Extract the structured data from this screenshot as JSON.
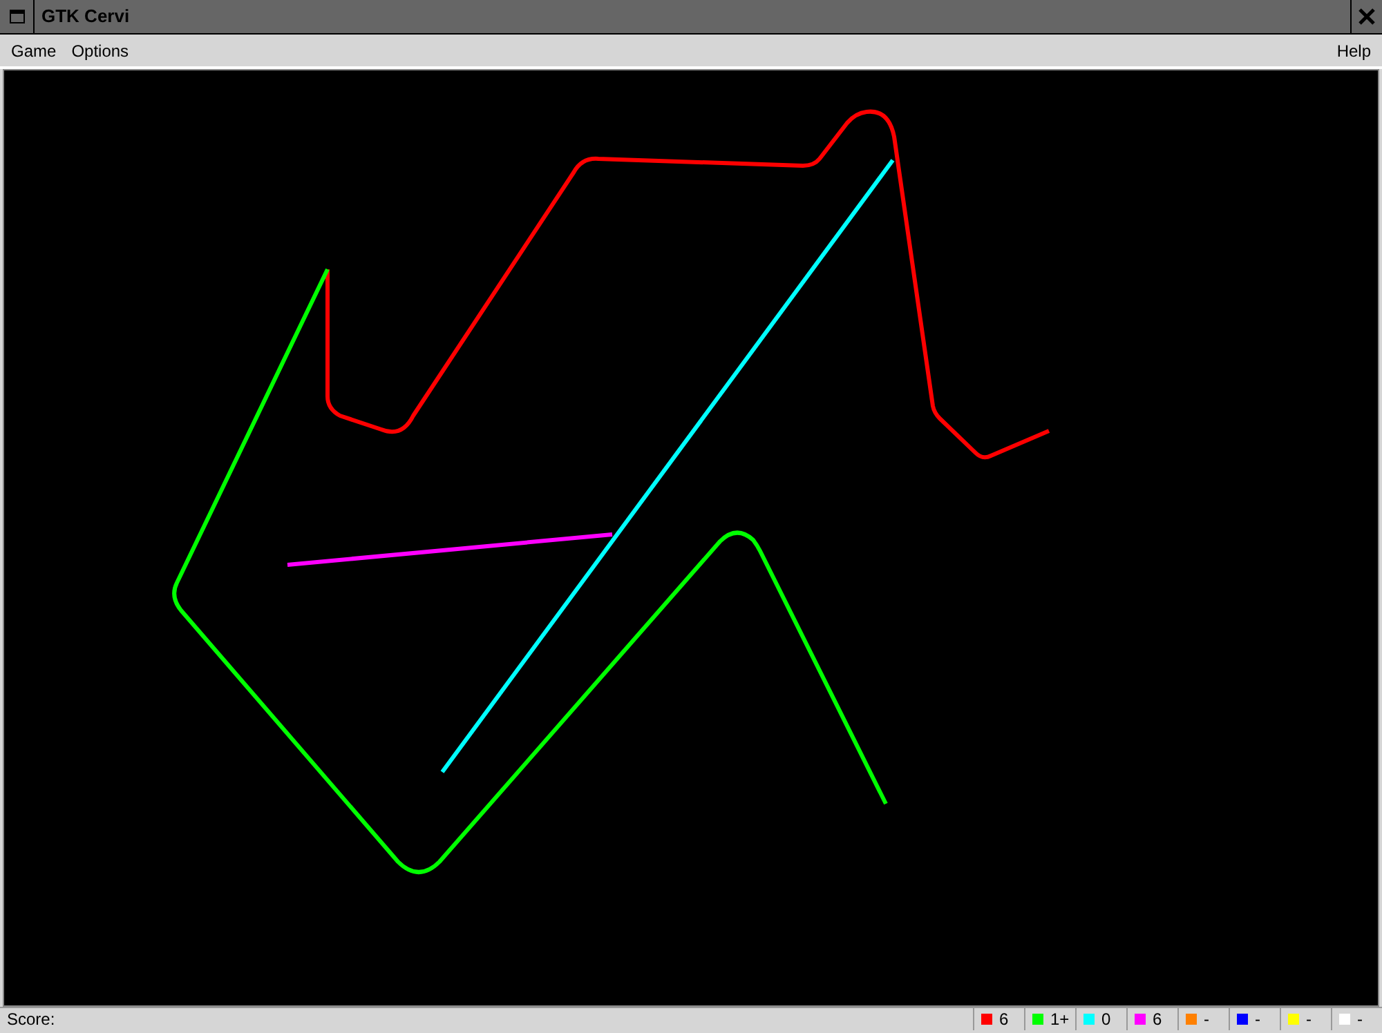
{
  "window": {
    "title": "GTK Cervi"
  },
  "menus": [
    {
      "label": "Game"
    },
    {
      "label": "Options"
    }
  ],
  "help_menu": {
    "label": "Help"
  },
  "status_bar": {
    "label": "Score:",
    "players": [
      {
        "color": "#ff0000",
        "score": "6"
      },
      {
        "color": "#00ff00",
        "score": "1+"
      },
      {
        "color": "#00ffff",
        "score": "0"
      },
      {
        "color": "#ff00ff",
        "score": "6"
      },
      {
        "color": "#ff8000",
        "score": "-"
      },
      {
        "color": "#0000ff",
        "score": "-"
      },
      {
        "color": "#ffff00",
        "score": "-"
      },
      {
        "color": "#ffffff",
        "score": "-"
      }
    ]
  }
}
